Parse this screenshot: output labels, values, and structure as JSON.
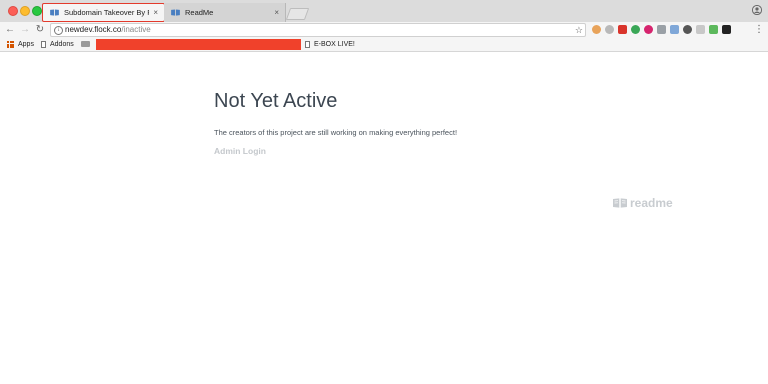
{
  "browser": {
    "tabs": [
      {
        "title": "Subdomain Takeover By Prial",
        "close": "×",
        "active": true
      },
      {
        "title": "ReadMe",
        "close": "×",
        "active": false
      }
    ],
    "url": {
      "host": "newdev.flock.co",
      "path": "/inactive"
    },
    "bookmarks": {
      "apps": "Apps",
      "addons": "Addons",
      "ebox": "E-BOX LIVE!"
    },
    "colors": {
      "highlight_border": "#e33a2c",
      "redaction": "#f0412b"
    }
  },
  "page": {
    "title": "Not Yet Active",
    "message": "The creators of this project are still working on making everything perfect!",
    "admin_link": "Admin Login",
    "brand": "readme"
  }
}
